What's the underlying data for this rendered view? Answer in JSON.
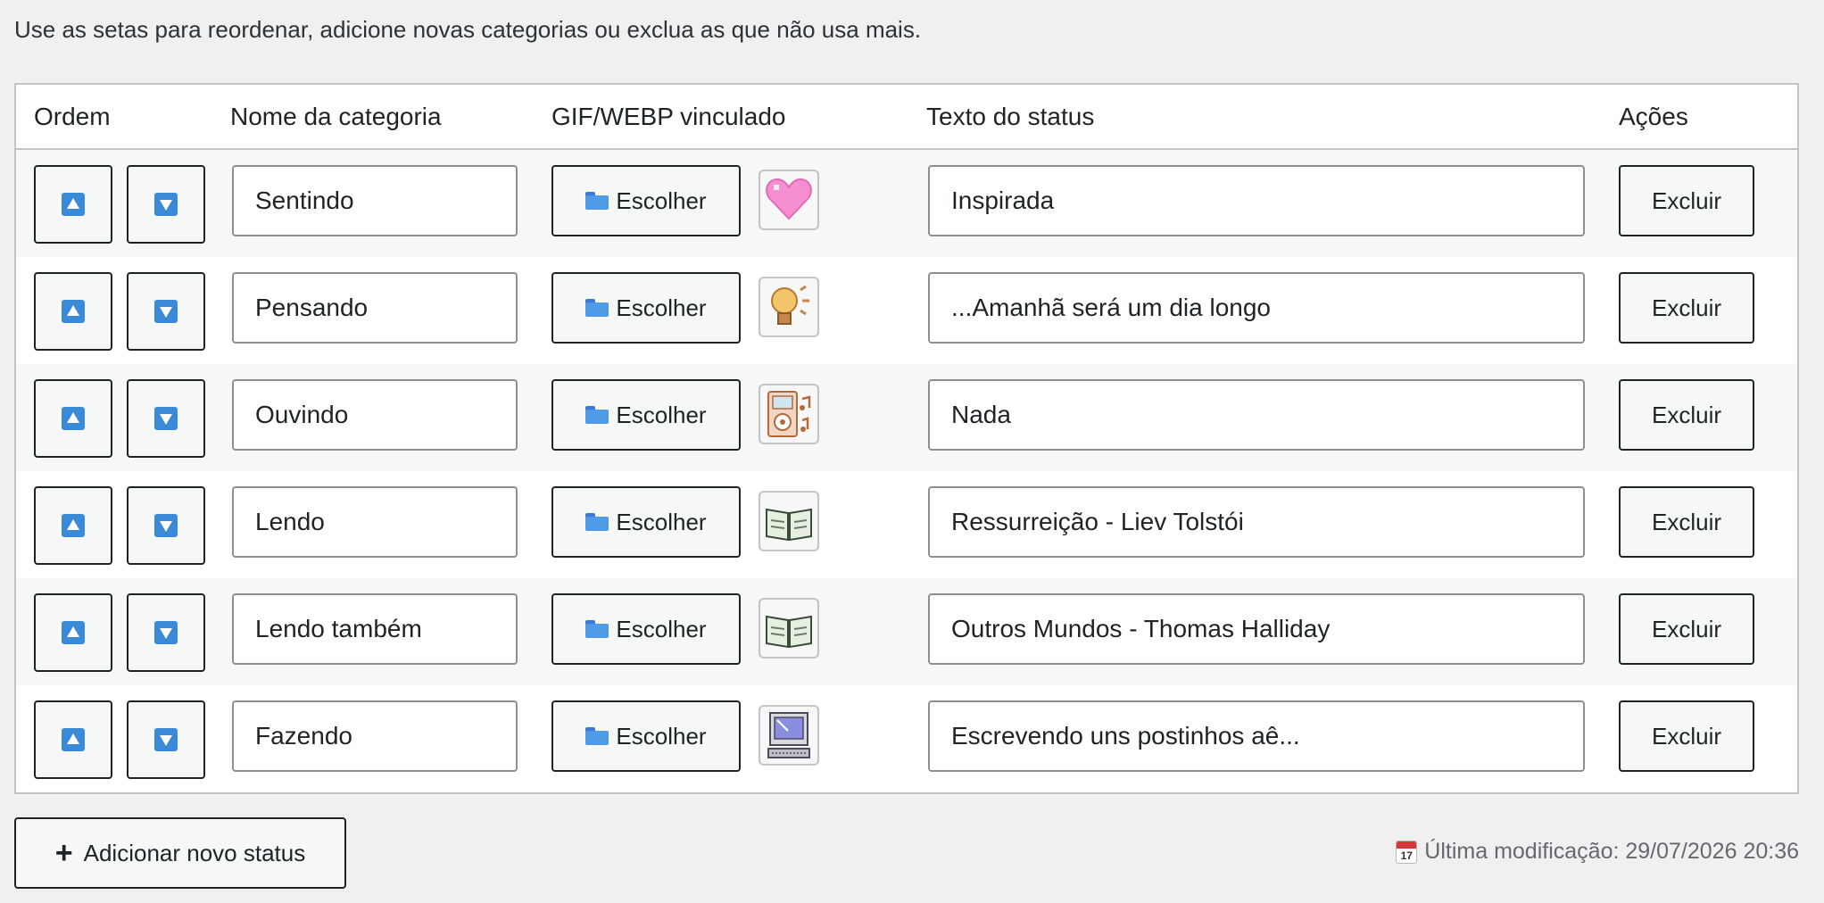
{
  "intro_text": "Use as setas para reordenar, adicione novas categorias ou exclua as que não usa mais.",
  "headers": {
    "order": "Ordem",
    "category": "Nome da categoria",
    "gif": "GIF/WEBP vinculado",
    "status": "Texto do status",
    "actions": "Ações"
  },
  "choose_label": "Escolher",
  "delete_label": "Excluir",
  "rows": [
    {
      "category": "Sentindo",
      "status": "Inspirada",
      "icon": "heart-icon"
    },
    {
      "category": "Pensando",
      "status": "...Amanhã será um dia longo",
      "icon": "lightbulb-icon"
    },
    {
      "category": "Ouvindo",
      "status": "Nada",
      "icon": "music-player-icon"
    },
    {
      "category": "Lendo",
      "status": "Ressurreição - Liev Tolstói",
      "icon": "book-icon"
    },
    {
      "category": "Lendo também",
      "status": "Outros Mundos - Thomas Halliday",
      "icon": "book-icon"
    },
    {
      "category": "Fazendo",
      "status": "Escrevendo uns postinhos aê...",
      "icon": "computer-icon"
    }
  ],
  "add_button_label": "Adicionar novo status",
  "calendar_day": "17",
  "last_modified": "Última modificação: 29/07/2026 20:36",
  "colors": {
    "accent": "#3b8ad8",
    "heart": "#f58fd0",
    "border": "#c3c4c7"
  }
}
